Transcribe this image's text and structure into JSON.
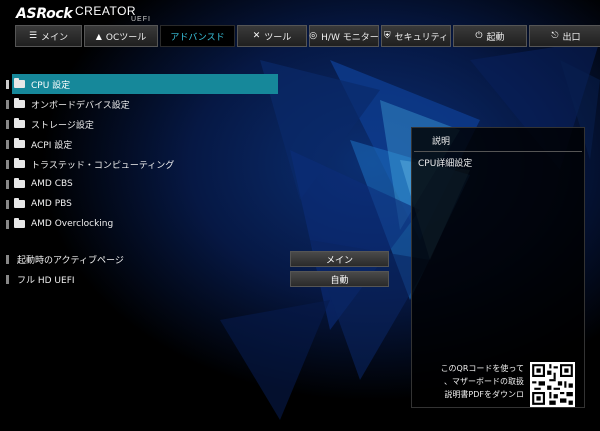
{
  "header": {
    "logo": "ASRock",
    "sub": "CREATOR",
    "uefi": "UEFI"
  },
  "tabs": [
    {
      "icon": "list-icon",
      "glyph": "☰",
      "label": "メイン",
      "active": false
    },
    {
      "icon": "flame-icon",
      "glyph": "🔥",
      "label": "OCツール",
      "active": false
    },
    {
      "icon": "",
      "glyph": "",
      "label": "アドバンスド",
      "active": true
    },
    {
      "icon": "tools-icon",
      "glyph": "✕",
      "label": "ツール",
      "active": false
    },
    {
      "icon": "gauge-icon",
      "glyph": "◎",
      "label": "H/W モニター",
      "active": false
    },
    {
      "icon": "shield-icon",
      "glyph": "⛨",
      "label": "セキュリティ",
      "active": false
    },
    {
      "icon": "power-icon",
      "glyph": "⏻",
      "label": "起動",
      "active": false
    },
    {
      "icon": "exit-icon",
      "glyph": "⎋",
      "label": "出口",
      "active": false
    }
  ],
  "menu": [
    {
      "label": "CPU 設定",
      "selected": true
    },
    {
      "label": "オンボードデバイス設定",
      "selected": false
    },
    {
      "label": "ストレージ設定",
      "selected": false
    },
    {
      "label": "ACPI 設定",
      "selected": false
    },
    {
      "label": "トラステッド・コンピューティング",
      "selected": false
    },
    {
      "label": "AMD CBS",
      "selected": false
    },
    {
      "label": "AMD PBS",
      "selected": false
    },
    {
      "label": "AMD Overclocking",
      "selected": false
    }
  ],
  "options": [
    {
      "label": "起動時のアクティブページ",
      "value": "メイン"
    },
    {
      "label": "フル HD UEFI",
      "value": "自動"
    }
  ],
  "help": {
    "title": "説明",
    "text": "CPU詳細設定",
    "qr_lines": [
      "このQRコードを使って",
      "、マザーボードの取扱",
      "説明書PDFをダウンロ"
    ]
  },
  "colors": {
    "accent": "#16889a",
    "active_tab_text": "#3ac6e0"
  }
}
